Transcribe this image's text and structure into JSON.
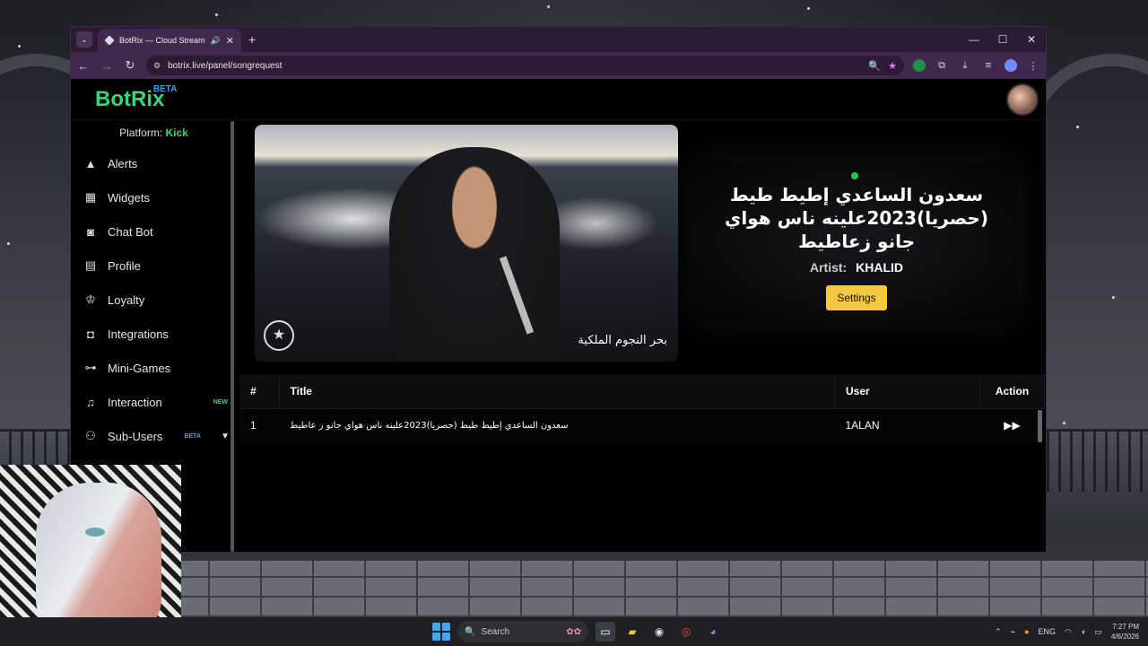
{
  "browser": {
    "tab_title": "BotRix — Cloud Streaming",
    "url": "botrix.live/panel/songrequest"
  },
  "app": {
    "logo": "BotRix",
    "logo_badge": "BETA",
    "platform_label": "Platform:",
    "platform_value": "Kick"
  },
  "sidebar": {
    "items": [
      {
        "label": "Alerts",
        "icon": "warning-icon"
      },
      {
        "label": "Widgets",
        "icon": "grid-icon"
      },
      {
        "label": "Chat Bot",
        "icon": "robot-icon"
      },
      {
        "label": "Profile",
        "icon": "id-card-icon"
      },
      {
        "label": "Loyalty",
        "icon": "trophy-icon"
      },
      {
        "label": "Integrations",
        "icon": "plug-icon"
      },
      {
        "label": "Mini-Games",
        "icon": "gamepad-icon"
      },
      {
        "label": "Interaction",
        "icon": "music-icon",
        "badge": "NEW"
      },
      {
        "label": "Sub-Users",
        "icon": "users-icon",
        "badge": "BETA"
      }
    ]
  },
  "player": {
    "watermark": "بحر النجوم الملكية"
  },
  "now_playing": {
    "title": "سعدون الساعدي إطيط طيط (حصريا)2023علينه ناس هواي جانو زعاطيط",
    "artist_label": "Artist:",
    "artist": "KHALID",
    "settings_label": "Settings"
  },
  "queue": {
    "headers": [
      "#",
      "Title",
      "User",
      "Action"
    ],
    "rows": [
      {
        "num": "1",
        "title": "سعدون الساعدي إطيط طيط (حصريا)2023علينه ناس هواي جانو ز عاطيط",
        "user": "1ALAN"
      }
    ]
  },
  "taskbar": {
    "search_placeholder": "Search",
    "lang": "ENG",
    "time": "7:27 PM",
    "date": "4/6/2026"
  },
  "colors": {
    "brand": "#37d67a",
    "accent_button": "#f5c842",
    "browser_frame": "#41294d"
  }
}
